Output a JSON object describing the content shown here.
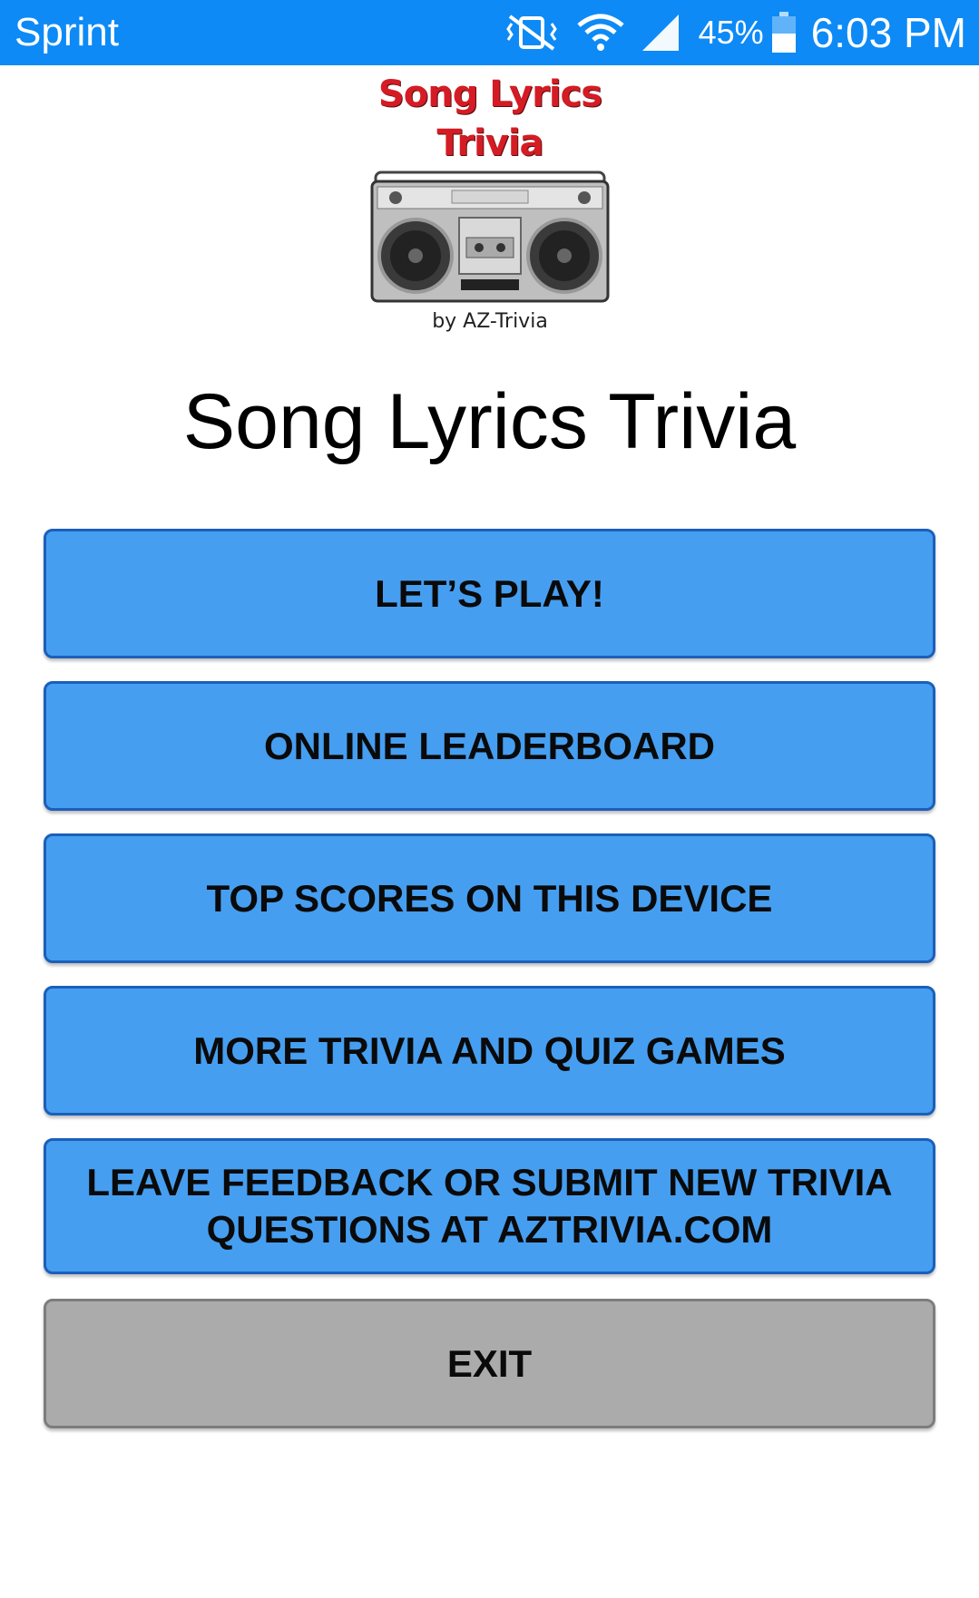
{
  "status_bar": {
    "carrier": "Sprint",
    "battery_percent": "45%",
    "time": "6:03 PM",
    "icons": [
      "vibrate-mute-icon",
      "wifi-icon",
      "signal-icon",
      "battery-icon"
    ]
  },
  "logo": {
    "title_line1": "Song Lyrics",
    "title_line2": "Trivia",
    "byline": "by AZ-Trivia",
    "image": "boombox-icon"
  },
  "app_title": "Song Lyrics Trivia",
  "menu": {
    "play": "LET’S PLAY!",
    "leaderboard": "ONLINE LEADERBOARD",
    "top_scores": "TOP SCORES ON THIS DEVICE",
    "more_games": "MORE TRIVIA AND QUIZ GAMES",
    "feedback": "LEAVE FEEDBACK OR SUBMIT NEW TRIVIA QUESTIONS AT AZTRIVIA.COM",
    "exit": "EXIT"
  },
  "colors": {
    "status_bar": "#0d8af6",
    "button": "#469ef0",
    "button_border": "#1b5fbb",
    "exit_button": "#ababab",
    "logo_title": "#d51c24"
  }
}
